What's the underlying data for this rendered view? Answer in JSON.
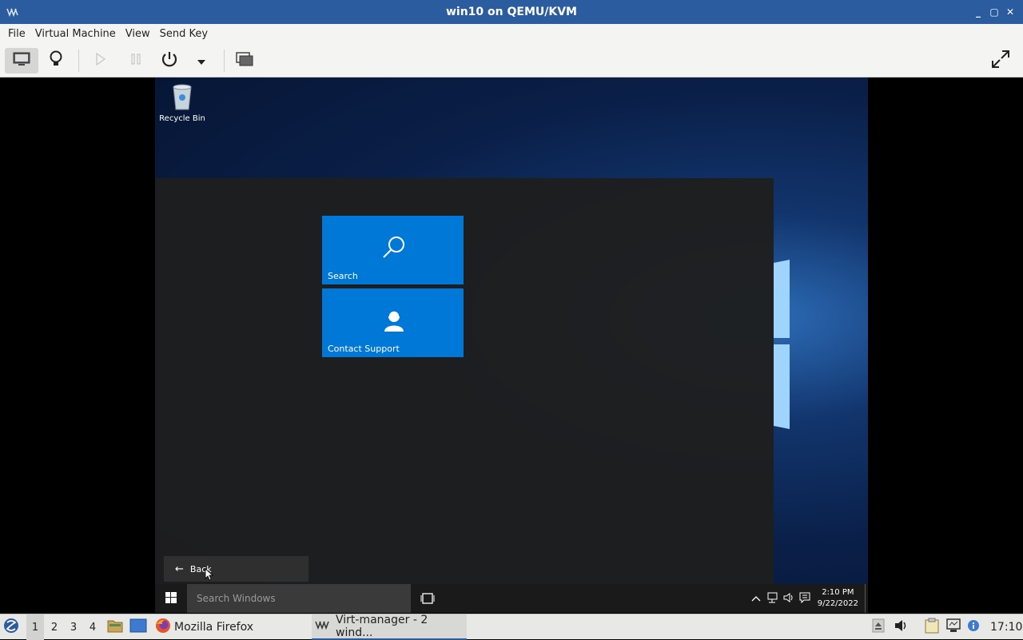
{
  "window": {
    "title": "win10 on QEMU/KVM",
    "controls": [
      "_",
      "▢",
      "✕"
    ]
  },
  "menu": [
    "File",
    "Virtual Machine",
    "View",
    "Send Key"
  ],
  "toolbar": {
    "buttons": [
      "monitor-icon",
      "lightbulb-icon",
      "play-icon",
      "pause-icon",
      "power-icon",
      "dropdown-icon",
      "screenshot-icon",
      "fullscreen-icon"
    ]
  },
  "guest": {
    "desktop_icon_label": "Recycle Bin",
    "tiles": [
      {
        "label": "Search"
      },
      {
        "label": "Contact Support"
      }
    ],
    "back_label": "Back",
    "search_placeholder": "Search Windows",
    "clock_time": "2:10 PM",
    "clock_date": "9/22/2022"
  },
  "host_panel": {
    "workspaces": [
      "1",
      "2",
      "3",
      "4"
    ],
    "tasks": [
      "Mozilla Firefox",
      "Virt-manager - 2 wind..."
    ],
    "time": "17:10"
  },
  "colors": {
    "titlebar": "#2b5ca0",
    "tile": "#0078d7",
    "startmenu": "#1e1e1e"
  }
}
